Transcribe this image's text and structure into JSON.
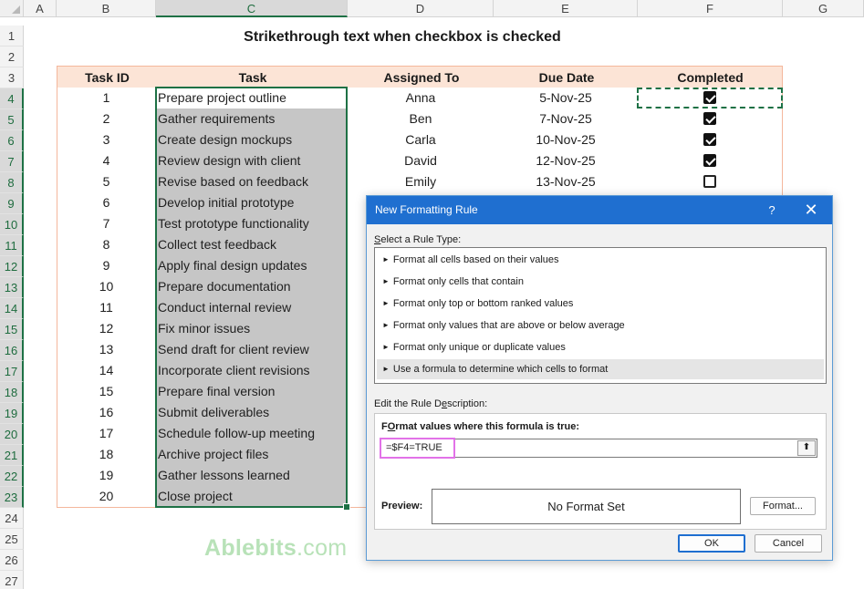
{
  "sheet": {
    "columns": [
      "A",
      "B",
      "C",
      "D",
      "E",
      "F",
      "G"
    ],
    "selected_column": "C",
    "rows": [
      "1",
      "2",
      "3",
      "4",
      "5",
      "6",
      "7",
      "8",
      "9",
      "10",
      "11",
      "12",
      "13",
      "14",
      "15",
      "16",
      "17",
      "18",
      "19",
      "20",
      "21",
      "22",
      "23",
      "24",
      "25",
      "26",
      "27"
    ],
    "title": "Strikethrough text when checkbox is checked",
    "headers": [
      "Task ID",
      "Task",
      "Assigned To",
      "Due Date",
      "Completed"
    ],
    "tasks": [
      {
        "id": "1",
        "task": "Prepare project outline",
        "assigned": "Anna",
        "due": "5-Nov-25",
        "done": true
      },
      {
        "id": "2",
        "task": "Gather requirements",
        "assigned": "Ben",
        "due": "7-Nov-25",
        "done": true
      },
      {
        "id": "3",
        "task": "Create design mockups",
        "assigned": "Carla",
        "due": "10-Nov-25",
        "done": true
      },
      {
        "id": "4",
        "task": "Review design with client",
        "assigned": "David",
        "due": "12-Nov-25",
        "done": true
      },
      {
        "id": "5",
        "task": "Revise based on feedback",
        "assigned": "Emily",
        "due": "13-Nov-25",
        "done": false
      },
      {
        "id": "6",
        "task": "Develop initial prototype"
      },
      {
        "id": "7",
        "task": "Test prototype functionality"
      },
      {
        "id": "8",
        "task": "Collect test feedback"
      },
      {
        "id": "9",
        "task": "Apply final design updates"
      },
      {
        "id": "10",
        "task": "Prepare documentation"
      },
      {
        "id": "11",
        "task": "Conduct internal review"
      },
      {
        "id": "12",
        "task": "Fix minor issues"
      },
      {
        "id": "13",
        "task": "Send draft for client review"
      },
      {
        "id": "14",
        "task": "Incorporate client revisions"
      },
      {
        "id": "15",
        "task": "Prepare final version"
      },
      {
        "id": "16",
        "task": "Submit deliverables"
      },
      {
        "id": "17",
        "task": "Schedule follow-up meeting"
      },
      {
        "id": "18",
        "task": "Archive project files"
      },
      {
        "id": "19",
        "task": "Gather lessons learned"
      },
      {
        "id": "20",
        "task": "Close project"
      }
    ]
  },
  "watermark": {
    "brand": "Ablebits",
    "domain": ".com"
  },
  "dialog": {
    "title": "New Formatting Rule",
    "help_glyph": "?",
    "close_glyph": "✕",
    "select_label_key": "S",
    "select_label_rest": "elect a Rule Type:",
    "rule_types": [
      "Format all cells based on their values",
      "Format only cells that contain",
      "Format only top or bottom ranked values",
      "Format only values that are above or below average",
      "Format only unique or duplicate values",
      "Use a formula to determine which cells to format"
    ],
    "selected_rule_index": 5,
    "edit_label_pre": "Edit the Rule D",
    "edit_label_key": "e",
    "edit_label_rest": "scription:",
    "formula_label_key": "O",
    "formula_label_pre": "F",
    "formula_label_rest": "rmat values where this formula is true:",
    "formula_value": "=$F4=TRUE",
    "preview_label": "Preview:",
    "preview_text": "No Format Set",
    "format_button": "Format...",
    "ok_button": "OK",
    "cancel_button": "Cancel"
  }
}
